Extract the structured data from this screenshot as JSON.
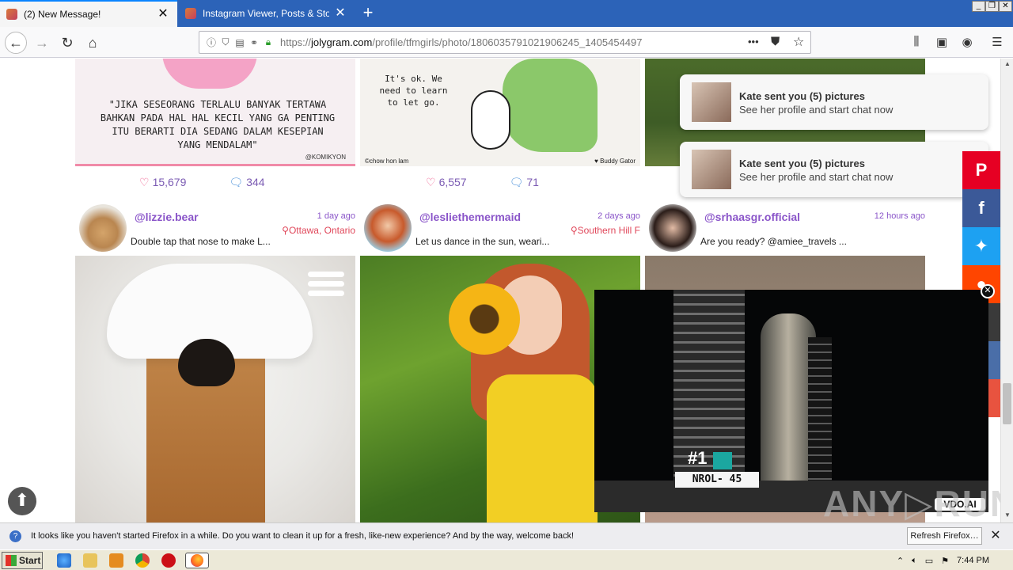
{
  "browser": {
    "tabs": [
      {
        "title": "(2) New Message!",
        "active": true
      },
      {
        "title": "Instagram Viewer, Posts & Story B",
        "active": false
      }
    ],
    "url_prefix": "https://",
    "url_domain": "jolygram.com",
    "url_path": "/profile/tfmgirls/photo/1806035791021906245_1405454497",
    "url_more": "•••"
  },
  "posts_top": [
    {
      "quote": "\"JIKA SESEORANG TERLALU BANYAK TERTAWA BAHKAN PADA HAL HAL KECIL YANG GA PENTING ITU BERARTI DIA SEDANG DALAM KESEPIAN YANG MENDALAM\"",
      "credit": "@KOMIKYON",
      "likes": "15,679",
      "comments": "344"
    },
    {
      "quote": "It's ok. We need to learn to let go.",
      "credit_left": "©chow hon lam",
      "credit_right": "♥ Buddy Gator",
      "likes": "6,557",
      "comments": "71"
    }
  ],
  "users": [
    {
      "name": "@lizzie.bear",
      "time": "1 day ago",
      "location": "Ottawa, Ontario",
      "caption": "Double tap that nose to make L..."
    },
    {
      "name": "@lesliethemermaid",
      "time": "2 days ago",
      "location": "Southern Hill F",
      "caption": "Let us dance in the sun, weari..."
    },
    {
      "name": "@srhaasgr.official",
      "time": "12 hours ago",
      "location": "",
      "caption": "Are you ready? @amiee_travels ..."
    }
  ],
  "notifications": [
    {
      "title": "Kate sent you (5) pictures",
      "subtitle": "See her profile and start chat now"
    },
    {
      "title": "Kate sent you (5) pictures",
      "subtitle": "See her profile and start chat now"
    }
  ],
  "social": [
    {
      "icon": "pinterest-icon",
      "glyph": "P",
      "color": "#e60023"
    },
    {
      "icon": "facebook-icon",
      "glyph": "f",
      "color": "#3b5998"
    },
    {
      "icon": "twitter-icon",
      "glyph": "🐦",
      "color": "#1da1f2"
    },
    {
      "icon": "reddit-icon",
      "glyph": "●",
      "color": "#ff4500"
    }
  ],
  "video": {
    "label": "NROL- 45",
    "number": "#1",
    "brand": "VDO.AI"
  },
  "watermark": "ANY▷RUN",
  "infobar": {
    "message": "It looks like you haven't started Firefox in a while. Do you want to clean it up for a fresh, like-new experience? And by the way, welcome back!",
    "button": "Refresh Firefox…"
  },
  "taskbar": {
    "start": "Start",
    "clock": "7:44 PM"
  }
}
